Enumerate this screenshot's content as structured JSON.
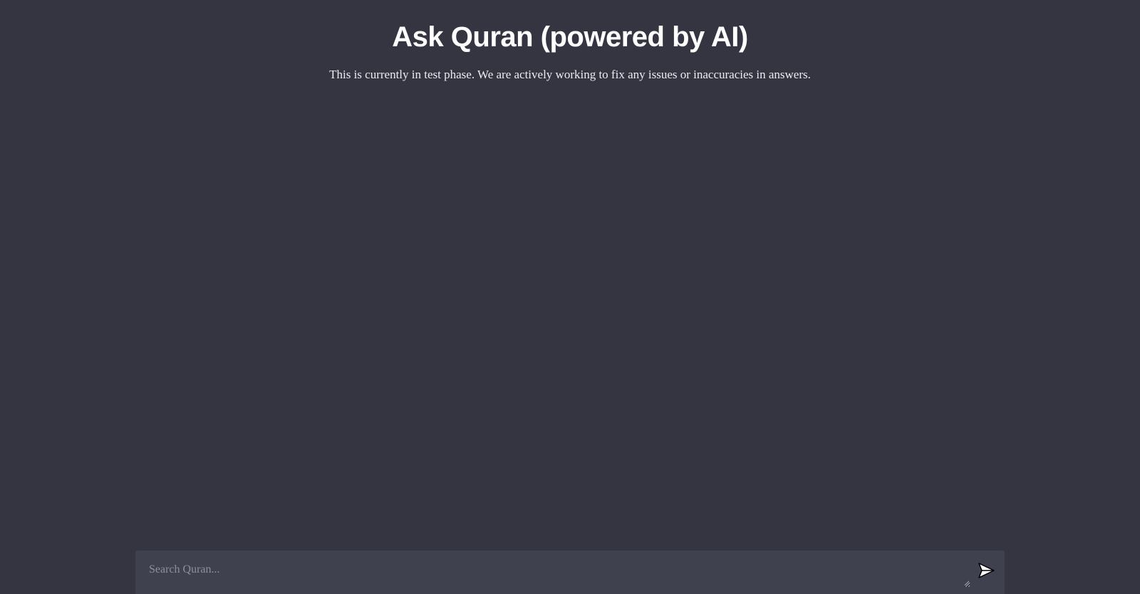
{
  "header": {
    "title": "Ask Quran (powered by AI)",
    "subtitle": "This is currently in test phase. We are actively working to fix any issues or inaccuracies in answers."
  },
  "search": {
    "placeholder": "Search Quran...",
    "value": ""
  },
  "icons": {
    "send": "send-icon"
  },
  "colors": {
    "background": "#343541",
    "input_background": "#40414f",
    "text": "#ffffff",
    "placeholder": "#8e8ea0"
  }
}
